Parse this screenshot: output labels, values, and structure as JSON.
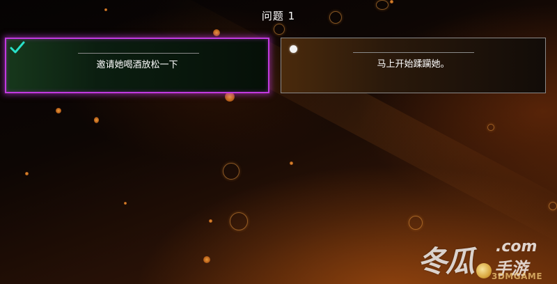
{
  "question": {
    "title": "问题 1"
  },
  "options": [
    {
      "text": "邀请她喝酒放松一下",
      "state": "selected",
      "icon": "checkmark-icon"
    },
    {
      "text": "马上开始蹂躏她。",
      "state": "unselected",
      "icon": "radio-dot-icon"
    }
  ],
  "colors": {
    "selected_border": "#c23ae0",
    "checkmark": "#29e0c8",
    "ember": "#e89a3a",
    "background_glow": "#c85f14"
  },
  "watermark": {
    "brand_main": "冬瓜",
    "brand_domain": ".com",
    "brand_sub": "手游",
    "brand_site": "3DMGAME"
  }
}
